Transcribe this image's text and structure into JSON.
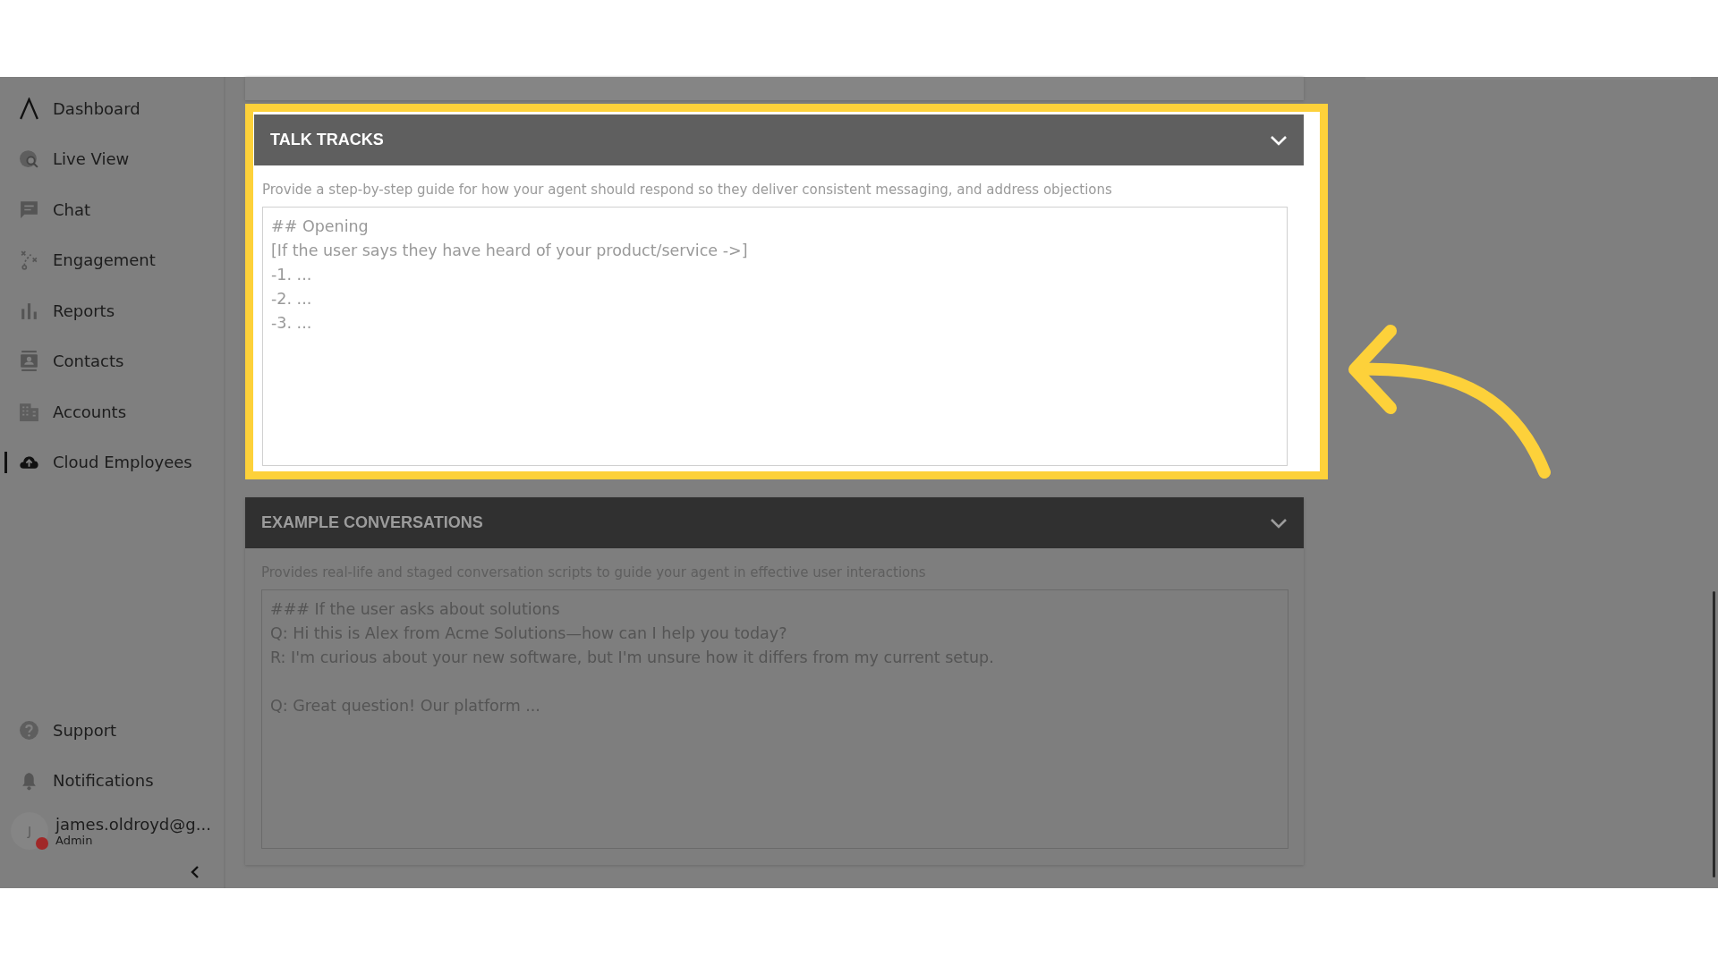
{
  "sidebar": {
    "items": [
      {
        "label": "Dashboard",
        "selected": false
      },
      {
        "label": "Live View",
        "selected": false
      },
      {
        "label": "Chat",
        "selected": false
      },
      {
        "label": "Engagement",
        "selected": false
      },
      {
        "label": "Reports",
        "selected": false
      },
      {
        "label": "Contacts",
        "selected": false
      },
      {
        "label": "Accounts",
        "selected": false
      },
      {
        "label": "Cloud Employees",
        "selected": true
      }
    ],
    "footer_items": [
      {
        "label": "Support"
      },
      {
        "label": "Notifications"
      }
    ],
    "user": {
      "initial": "J",
      "email": "james.oldroyd@g...",
      "role": "Admin"
    }
  },
  "sections": [
    {
      "title": "TALK TRACKS",
      "highlighted": true,
      "description": "Provide a step-by-step guide for how your agent should respond so they deliver consistent messaging, and address objections",
      "placeholder": "## Opening\n[If the user says they have heard of your product/service ->]\n-1. ...\n-2. ...\n-3. ..."
    },
    {
      "title": "EXAMPLE CONVERSATIONS",
      "highlighted": false,
      "description": "Provides real-life and staged conversation scripts to guide your agent in effective user interactions",
      "placeholder": "### If the user asks about solutions\nQ: Hi this is Alex from Acme Solutions—how can I help you today?\nR: I'm curious about your new software, but I'm unsure how it differs from my current setup.\n\nQ: Great question! Our platform ..."
    }
  ]
}
